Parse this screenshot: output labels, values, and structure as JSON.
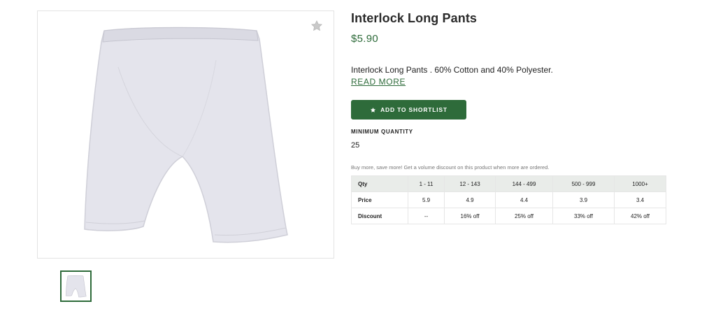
{
  "product": {
    "title": "Interlock Long Pants",
    "price": "$5.90",
    "description": "Interlock Long Pants . 60% Cotton and 40% Polyester.",
    "read_more": "READ MORE",
    "shortlist_label": "ADD TO SHORTLIST",
    "min_qty_label": "MINIMUM QUANTITY",
    "min_qty_value": "25",
    "bulk_note": "Buy more, save more! Get a volume discount on this product when more are ordered."
  },
  "gallery": {
    "favorite_icon": "star-icon",
    "thumbnail_icon": "pants-thumbnail"
  },
  "pricing_table": {
    "header": [
      "Qty",
      "1 - 11",
      "12 - 143",
      "144 - 499",
      "500 - 999",
      "1000+"
    ],
    "price_row": [
      "Price",
      "5.9",
      "4.9",
      "4.4",
      "3.9",
      "3.4"
    ],
    "discount_row": [
      "Discount",
      "--",
      "16% off",
      "25% off",
      "33% off",
      "42% off"
    ]
  },
  "colors": {
    "accent": "#2e6b3a",
    "table_header_bg": "#e9ece9"
  }
}
